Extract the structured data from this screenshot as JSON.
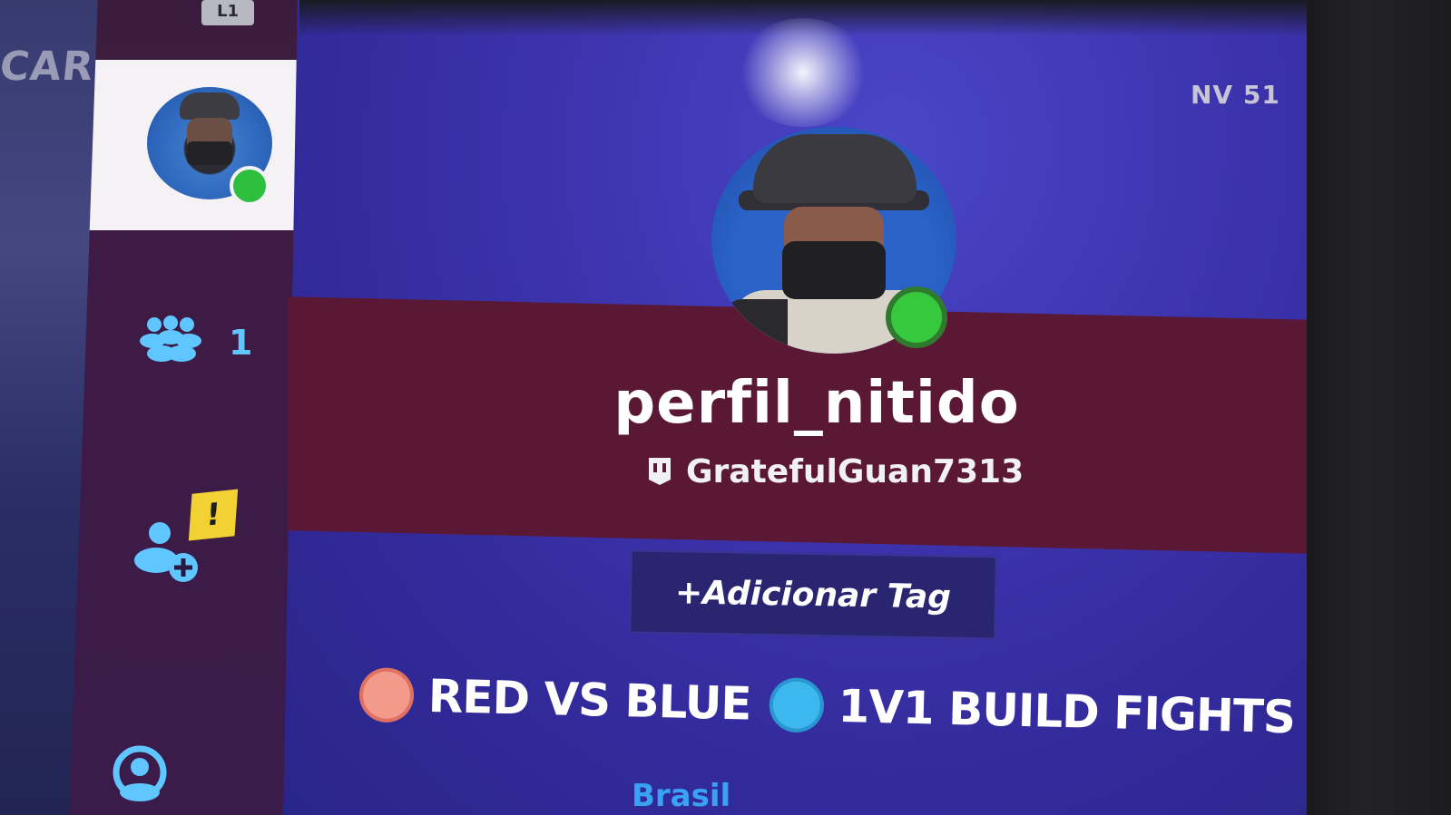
{
  "background": {
    "left_text": "CARR"
  },
  "sidebar": {
    "top_badge": "L1",
    "friends_count": "1",
    "alert_badge": "!"
  },
  "profile": {
    "level": "NV 51",
    "username": "perfil_nitido",
    "epic_id": "GratefulGuan7313",
    "add_tag_label": "+Adicionar Tag",
    "status": "online",
    "tags": [
      {
        "label": "RED VS BLUE",
        "color": "#f29a8c"
      },
      {
        "label": "1V1 BUILD FIGHTS",
        "color": "#3cb8ee"
      }
    ],
    "bottom_partial": "Brasil"
  },
  "colors": {
    "accent_blue": "#5fc6ff",
    "online_green": "#36c93e",
    "banner": "#5a1835",
    "alert_yellow": "#f1d232"
  },
  "icons": [
    "friends-icon",
    "add-friend-icon",
    "support-icon",
    "epic-games-icon",
    "diamond-icon"
  ]
}
